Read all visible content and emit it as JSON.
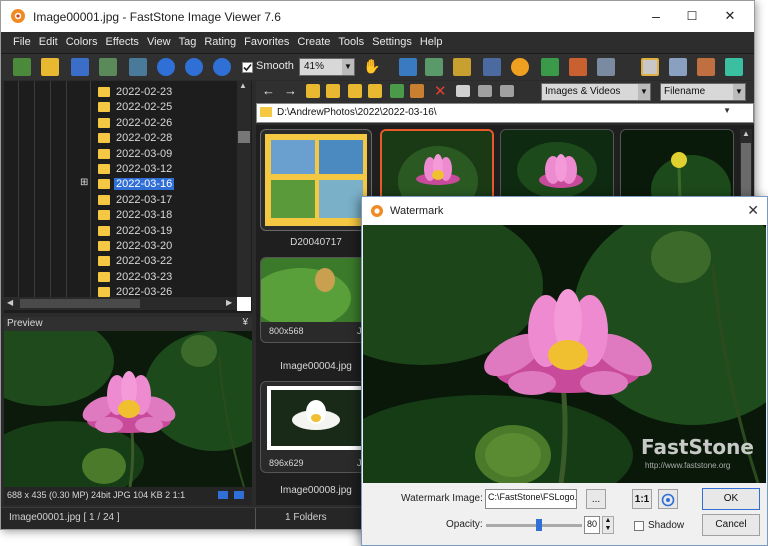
{
  "window": {
    "title": "Image00001.jpg - FastStone Image Viewer 7.6",
    "min_glyph": "–",
    "max_glyph": "☐",
    "close_glyph": "✕"
  },
  "menu": [
    "File",
    "Edit",
    "Colors",
    "Effects",
    "View",
    "Tag",
    "Rating",
    "Favorites",
    "Create",
    "Tools",
    "Settings",
    "Help"
  ],
  "toolbar": {
    "smooth_label": "Smooth",
    "zoom_value": "41%"
  },
  "folders": {
    "items": [
      "2022-02-23",
      "2022-02-25",
      "2022-02-26",
      "2022-02-28",
      "2022-03-09",
      "2022-03-12",
      "2022-03-16",
      "2022-03-17",
      "2022-03-18",
      "2022-03-19",
      "2022-03-20",
      "2022-03-22",
      "2022-03-23",
      "2022-03-26"
    ],
    "selected_index": 6,
    "expand_glyph": "⊞"
  },
  "preview": {
    "header": "Preview",
    "collapse_glyph": "¥",
    "info": "688 x 435 (0.30 MP)  24bit  JPG   104 KB   2 1:1"
  },
  "status": {
    "file": "Image00001.jpg [ 1 / 24 ]",
    "folders": "1 Folders"
  },
  "browser": {
    "filter": "Images & Videos",
    "sort": "Filename",
    "path": "D:\\AndrewPhotos\\2022\\2022-03-16\\",
    "thumbs": [
      {
        "caption": "D20040717",
        "dims": "",
        "type": ""
      },
      {
        "caption": "Image00004.jpg",
        "dims": "800x568",
        "type": "JP"
      },
      {
        "caption": "Image00008.jpg",
        "dims": "896x629",
        "type": "JP"
      }
    ]
  },
  "dialog": {
    "title": "Watermark",
    "watermark_label": "Watermark Image:",
    "watermark_path": "C:\\FastStone\\FSLogo.",
    "browse_label": "...",
    "ratio_label": "1:1",
    "opacity_label": "Opacity:",
    "opacity_value": "80",
    "opacity_fraction": 0.55,
    "shadow_label": "Shadow",
    "ok_label": "OK",
    "cancel_label": "Cancel",
    "logo_text": "FastStone",
    "logo_url": "http://www.faststone.org"
  },
  "colors": {
    "accent": "#2f6fd6",
    "selection_border": "#e85a2a",
    "folder": "#f4c842"
  }
}
